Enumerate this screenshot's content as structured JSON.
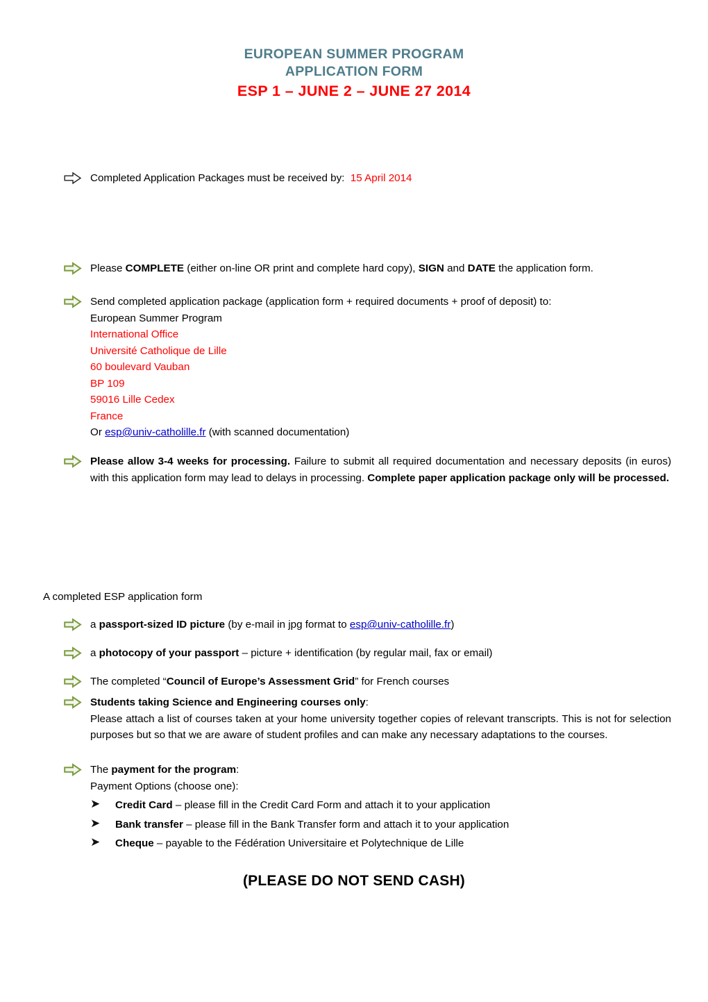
{
  "header": {
    "line1": "EUROPEAN SUMMER PROGRAM",
    "line2": "APPLICATION FORM",
    "line3": "ESP 1 – JUNE 2 – JUNE 27 2014",
    "color_teal": "#4f7d8c",
    "color_red": "#ff0000"
  },
  "deadline": {
    "bullet_icon": "arrow-right-outline-black-icon",
    "label": "Completed Application Packages must be received by:",
    "date": "15 April 2014"
  },
  "complete": {
    "bullet_icon": "arrow-right-green-icon",
    "part1": "Please ",
    "bold1": "COMPLETE",
    "part2": " (either on-line OR print and complete hard copy), ",
    "bold2": "SIGN",
    "part3": " and ",
    "bold3": "DATE",
    "part4": " the application form."
  },
  "send": {
    "bullet_icon": "arrow-right-green-icon",
    "intro": "Send completed application package (application form + required documents + proof of deposit) to:",
    "address": [
      {
        "text": "European Summer Program",
        "color": "black"
      },
      {
        "text": "International Office",
        "color": "red"
      },
      {
        "text": "Université Catholique de Lille",
        "color": "red"
      },
      {
        "text": "60 boulevard Vauban",
        "color": "red"
      },
      {
        "text": "BP 109",
        "color": "red"
      },
      {
        "text": "59016 Lille Cedex",
        "color": "red"
      },
      {
        "text": "France",
        "color": "red"
      }
    ],
    "or_prefix": "Or ",
    "email": "esp@univ-catholille.fr",
    "or_suffix": " (with scanned documentation)"
  },
  "allow": {
    "bullet_icon": "arrow-right-green-icon",
    "bold1": "Please allow 3-4 weeks for processing.",
    "text1": " Failure to submit all required documentation and necessary deposits (in euros) with this application form may lead to delays in processing. ",
    "bold2": "Complete paper application package only will be processed."
  },
  "checklist": {
    "intro": "A completed ESP application form",
    "items": [
      {
        "bullet_icon": "arrow-right-green-icon",
        "prefix": "a ",
        "bold": "passport-sized ID picture",
        "mid": " (by e-mail in jpg format to ",
        "email": "esp@univ-catholille.fr",
        "suffix": ")"
      },
      {
        "bullet_icon": "arrow-right-green-icon",
        "prefix": "a ",
        "bold": "photocopy of your passport",
        "suffix": " – picture + identification (by regular mail, fax or email)"
      },
      {
        "bullet_icon": "arrow-right-green-icon",
        "prefix": "The completed “",
        "bold": "Council of Europe’s Assessment Grid",
        "suffix": "” for French courses"
      }
    ],
    "science": {
      "bullet_icon": "arrow-right-green-icon",
      "bold": "Students taking Science and Engineering courses only",
      "colon": ":",
      "body": "Please attach a list of courses taken at your home university together copies of relevant transcripts.  This is not for selection purposes but so that we are aware of student profiles and can make any necessary adaptations to the courses."
    }
  },
  "payment": {
    "bullet_icon": "arrow-right-green-icon",
    "prefix": "The ",
    "bold": "payment for the program",
    "colon": ":",
    "options_label": "Payment Options (choose one):",
    "options": [
      {
        "bullet_icon": "arrowhead-right-icon",
        "bold": "Credit Card",
        "text": " – please fill in the Credit Card Form and attach it to your application"
      },
      {
        "bullet_icon": "arrowhead-right-icon",
        "bold": "Bank transfer",
        "text": " – please fill in the Bank Transfer form and attach it to your application"
      },
      {
        "bullet_icon": "arrowhead-right-icon",
        "bold": "Cheque",
        "text": " – payable to the Fédération Universitaire et Polytechnique de Lille"
      }
    ]
  },
  "footer": {
    "no_cash": "(PLEASE DO NOT SEND CASH)"
  }
}
